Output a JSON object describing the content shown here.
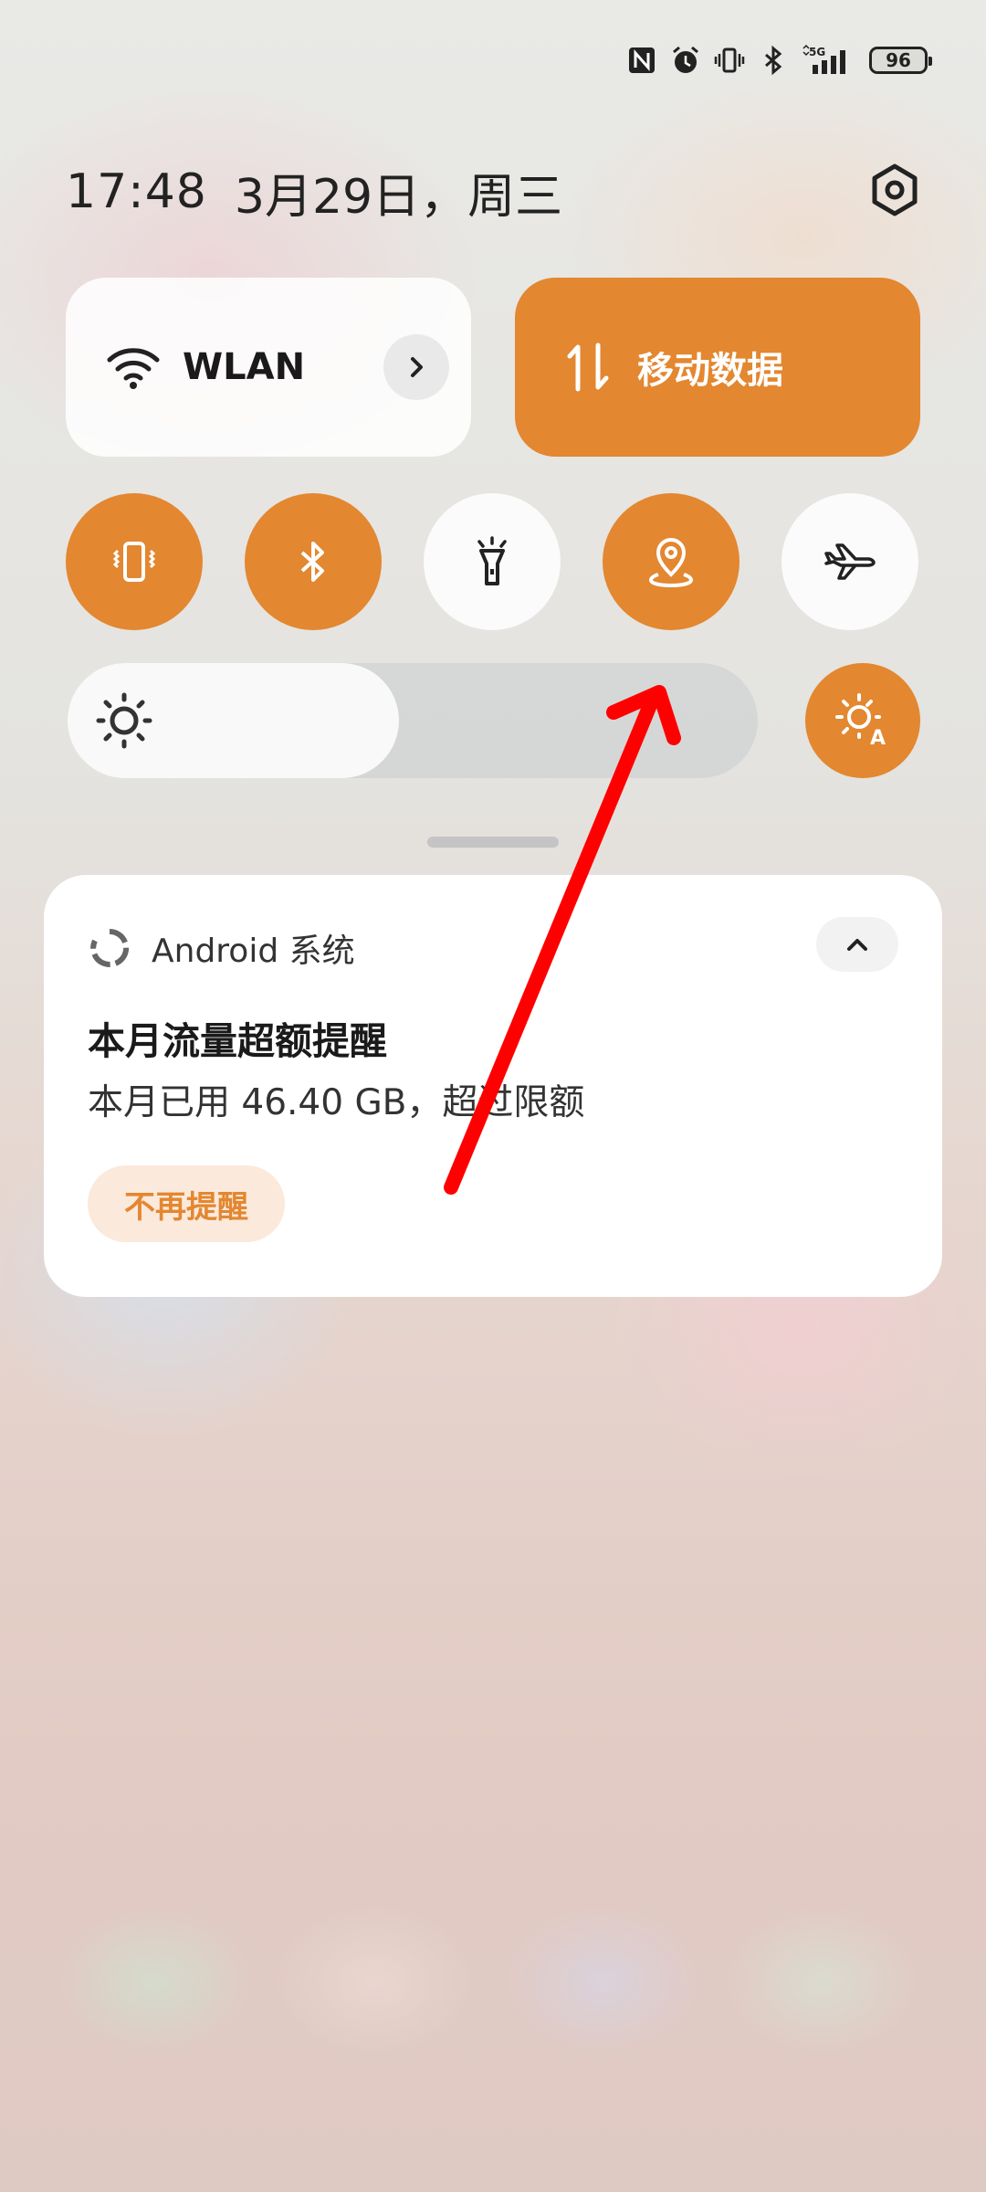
{
  "status_bar": {
    "icons": [
      "nfc-icon",
      "alarm-icon",
      "vibrate-icon",
      "bluetooth-icon",
      "5g-signal-icon",
      "battery-icon"
    ],
    "network": "5G",
    "battery": "96"
  },
  "header": {
    "time": "17:48",
    "date": "3月29日，周三",
    "settings_icon": "settings-hexagon-icon"
  },
  "tiles": {
    "wlan": {
      "label": "WLAN",
      "icon": "wifi-icon"
    },
    "mobile_data": {
      "label": "移动数据",
      "icon": "data-arrows-icon"
    }
  },
  "toggles": [
    {
      "name": "vibrate",
      "state": "on",
      "icon": "vibrate-icon"
    },
    {
      "name": "bluetooth",
      "state": "on",
      "icon": "bluetooth-icon"
    },
    {
      "name": "flashlight",
      "state": "off",
      "icon": "flashlight-icon"
    },
    {
      "name": "location",
      "state": "on",
      "icon": "location-icon"
    },
    {
      "name": "airplane",
      "state": "off",
      "icon": "airplane-icon"
    }
  ],
  "brightness": {
    "level_fraction": 0.48,
    "auto": true
  },
  "notification": {
    "app_name": "Android 系统",
    "title": "本月流量超额提醒",
    "body": "本月已用 46.40 GB，超过限额",
    "action": "不再提醒"
  },
  "colors": {
    "accent": "#e38730",
    "annotation": "#ff0000"
  }
}
